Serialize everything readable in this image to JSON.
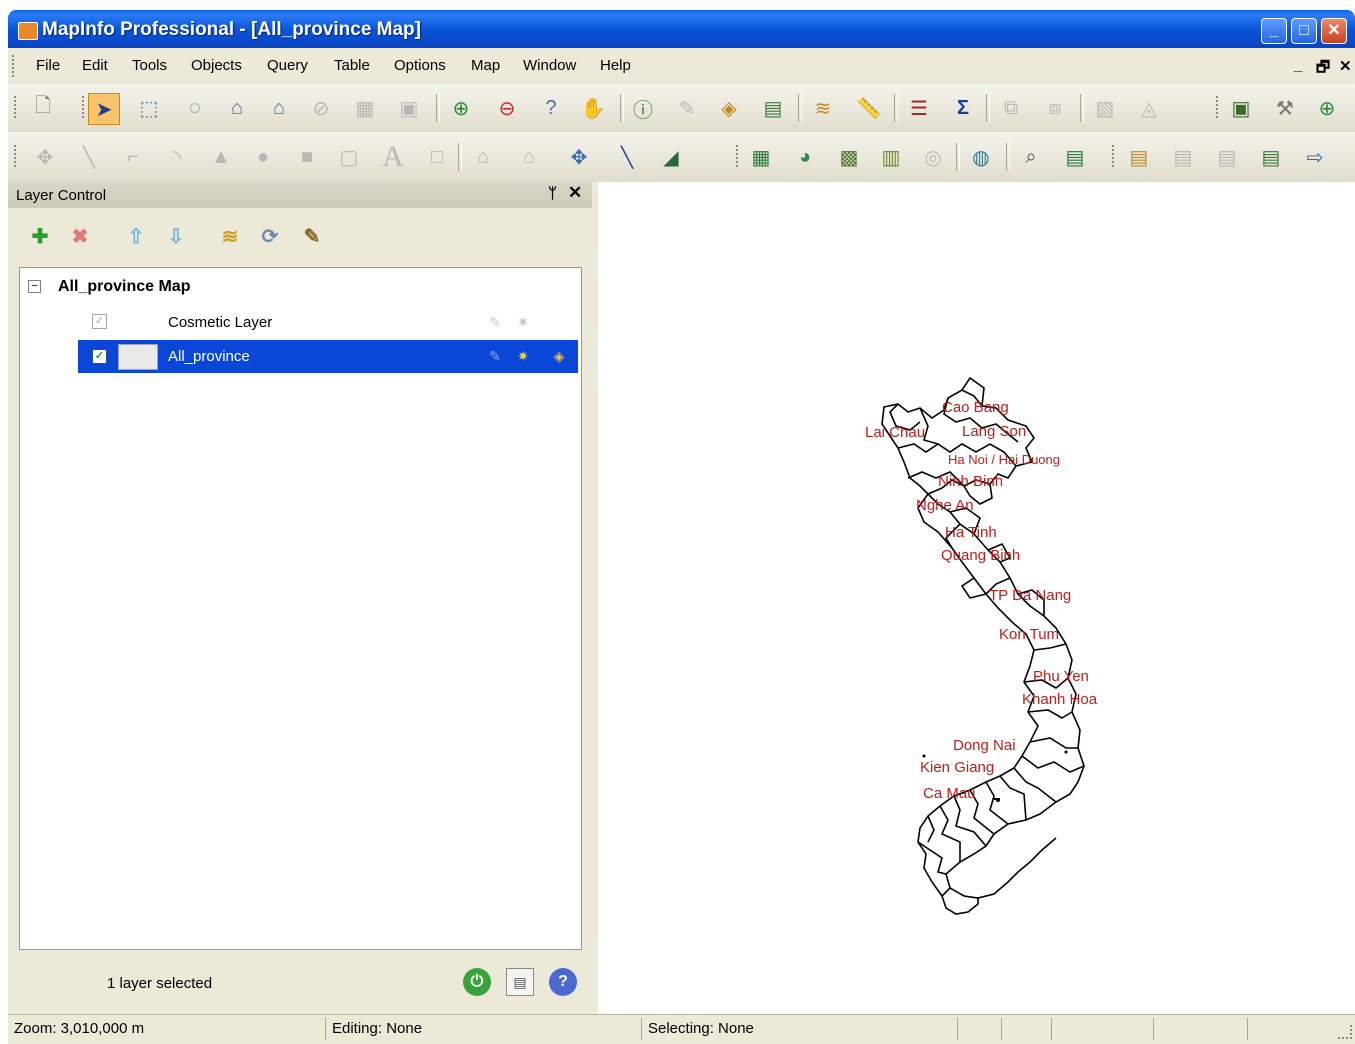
{
  "window": {
    "title": "MapInfo Professional - [All_province Map]",
    "minimize": "_",
    "maximize": "□",
    "close": "✕"
  },
  "menu": {
    "items": [
      "File",
      "Edit",
      "Tools",
      "Objects",
      "Query",
      "Table",
      "Options",
      "Map",
      "Window",
      "Help"
    ],
    "mdi_controls": [
      "_",
      "🗗",
      "✕"
    ]
  },
  "toolbars": {
    "main": [
      "new-document",
      "select",
      "marquee-select",
      "radius-select",
      "polygon-select",
      "boundary-select",
      "unselect-all",
      "graph-select",
      "invert-selection",
      "zoom-in",
      "zoom-out",
      "change-view",
      "grabber",
      "info",
      "ruler-tool",
      "label",
      "hotlink",
      "layer-control",
      "measure",
      "legend",
      "statistics",
      "drag-window",
      "show-cosmetic",
      "thematic",
      "clip-region",
      "layout",
      "tools",
      "web-globe"
    ],
    "drawing": [
      "symbol",
      "line",
      "polyline",
      "arc",
      "polygon",
      "ellipse",
      "rectangle",
      "rounded-rectangle",
      "text",
      "frame",
      "reshape",
      "add-node",
      "add-symbol",
      "add-line",
      "add-polygon"
    ],
    "extra": [
      "map-browser",
      "geocode",
      "map-window",
      "graph",
      "region",
      "globe",
      "find",
      "calculator",
      "table-1",
      "table-2",
      "table-3",
      "table-4",
      "export"
    ]
  },
  "layer_control": {
    "title": "Layer Control",
    "pin": "ᛘ",
    "close": "✕",
    "root_label": "All_province Map",
    "layers": [
      {
        "name": "Cosmetic Layer",
        "visible": true,
        "selected": false
      },
      {
        "name": "All_province",
        "visible": true,
        "selected": true
      }
    ],
    "selection_count": "1 layer selected"
  },
  "map": {
    "labels": [
      {
        "text": "Cao Bang"
      },
      {
        "text": "Lai Chau"
      },
      {
        "text": "Lang Son"
      },
      {
        "text": "Ha Noi / Hai Duong"
      },
      {
        "text": "Ninh Binh"
      },
      {
        "text": "Nghe An"
      },
      {
        "text": "Ha Tinh"
      },
      {
        "text": "Quang Binh"
      },
      {
        "text": "TP Da Nang"
      },
      {
        "text": "Kon Tum"
      },
      {
        "text": "Phu Yen"
      },
      {
        "text": "Khanh Hoa"
      },
      {
        "text": "Dong Nai"
      },
      {
        "text": "Kien Giang"
      },
      {
        "text": "Ca Mau"
      }
    ]
  },
  "status": {
    "zoom": "Zoom: 3,010,000 m",
    "editing": "Editing: None",
    "selecting": "Selecting: None"
  },
  "colors": {
    "titlebar": "#0b56d8",
    "selection": "#0a46d8",
    "map_label": "#c21a1a",
    "chrome": "#ece9d8"
  }
}
